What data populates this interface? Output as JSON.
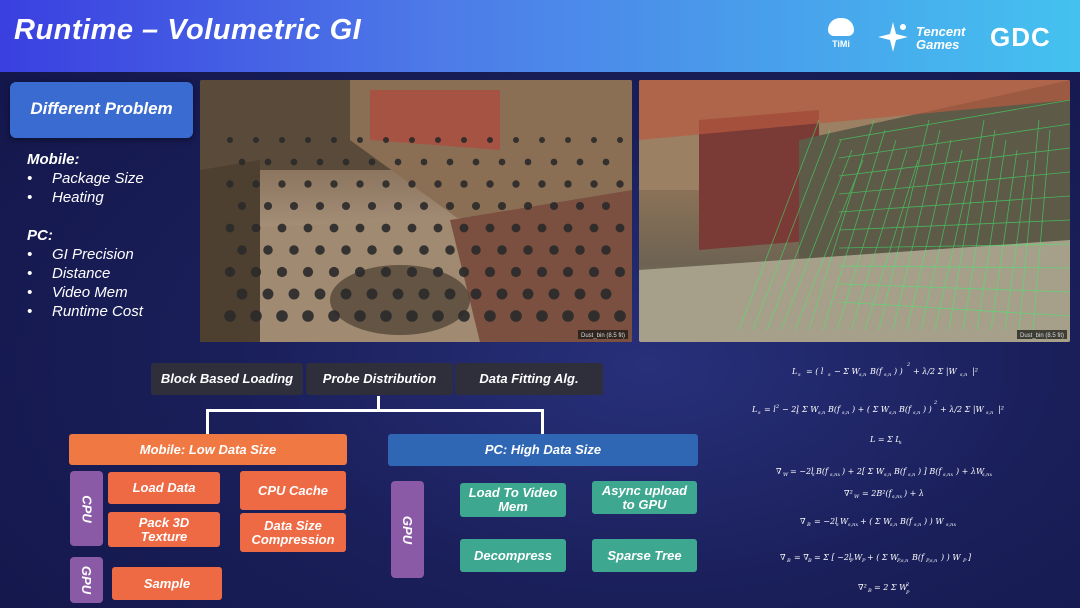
{
  "header": {
    "title": "Runtime – Volumetric GI",
    "logos": {
      "timi": "TiMi",
      "tencent_line1": "Tencent",
      "tencent_line2": "Games",
      "gdc": "GDC"
    }
  },
  "sidebar": {
    "badge": "Different Problem",
    "mobile": {
      "heading": "Mobile:",
      "items": [
        "Package Size",
        "Heating"
      ]
    },
    "pc": {
      "heading": "PC:",
      "items": [
        "GI Precision",
        "Distance",
        "Video Mem",
        "Runtime Cost"
      ]
    }
  },
  "screenshots": {
    "left_caption": "Dust_bin (8.5 fit)",
    "right_caption": "Dust_bin (8.5 fit)"
  },
  "diagram": {
    "top": [
      "Block Based Loading",
      "Probe Distribution",
      "Data Fitting Alg."
    ],
    "mobile": {
      "header": "Mobile: Low Data Size",
      "cpu_label": "CPU",
      "gpu_label": "GPU",
      "load_data": "Load Data",
      "pack_line1": "Pack 3D",
      "pack_line2": "Texture",
      "sample": "Sample",
      "cpu_cache": "CPU Cache",
      "compress_line1": "Data Size",
      "compress_line2": "Compression"
    },
    "pc": {
      "header": "PC: High Data Size",
      "gpu_label": "GPU",
      "load_line1": "Load To Video",
      "load_line2": "Mem",
      "async_line1": "Async upload",
      "async_line2": "to GPU",
      "decompress": "Decompress",
      "sparse_tree": "Sparse Tree"
    }
  },
  "colors": {
    "header_start": "#3a3fe0",
    "header_end": "#44c2ef",
    "orange": "#ee6a45",
    "blue": "#2f67b5",
    "purple": "#8a5aa6",
    "teal": "#3ea78f",
    "dark": "#2e2f3b"
  }
}
